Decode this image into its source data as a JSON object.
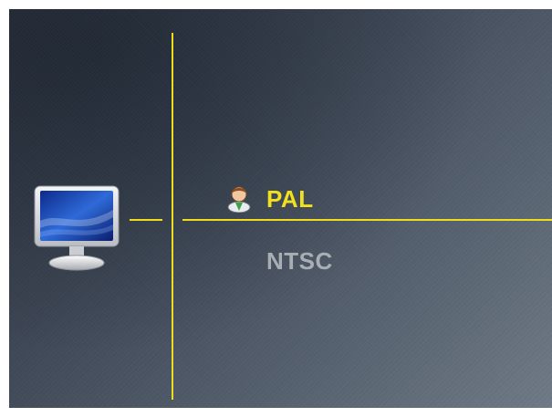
{
  "menu": {
    "items": [
      {
        "label": "PAL",
        "selected": true,
        "icon": "user-icon"
      },
      {
        "label": "NTSC",
        "selected": false
      }
    ]
  },
  "icons": {
    "device": "monitor-icon"
  },
  "colors": {
    "accent": "#f0dc1e",
    "selected_text": "#f2e01f",
    "unselected_text": "#a9aeb5",
    "background": "#3d4654"
  }
}
